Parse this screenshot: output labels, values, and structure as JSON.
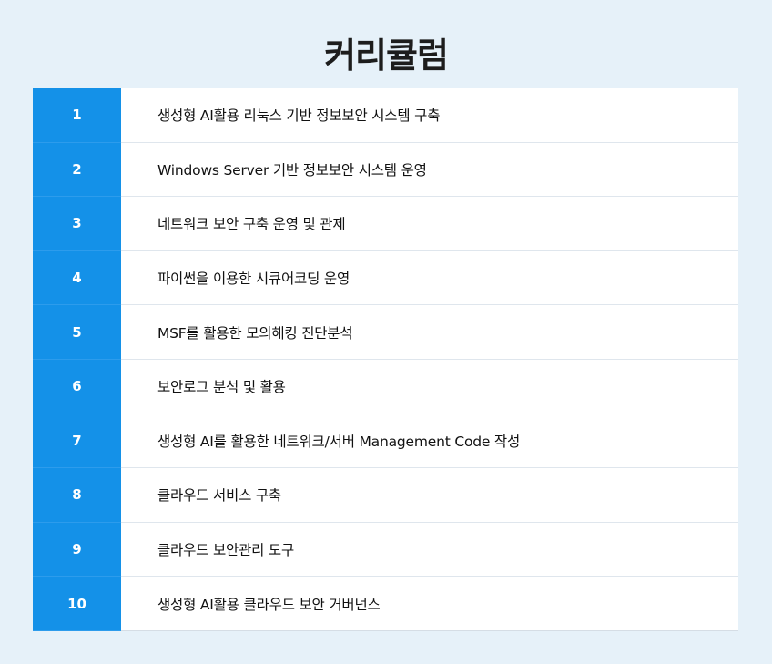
{
  "title": "커리큘럼",
  "colors": {
    "background": "#e6f1f9",
    "number_column": "#1491e8",
    "text": "#111111"
  },
  "curriculum": [
    {
      "number": "1",
      "label": "생성형 AI활용 리눅스 기반 정보보안 시스템 구축"
    },
    {
      "number": "2",
      "label": "Windows Server 기반 정보보안 시스템 운영"
    },
    {
      "number": "3",
      "label": "네트워크 보안 구축 운영 및 관제"
    },
    {
      "number": "4",
      "label": "파이썬을 이용한 시큐어코딩 운영"
    },
    {
      "number": "5",
      "label": "MSF를 활용한 모의해킹 진단분석"
    },
    {
      "number": "6",
      "label": "보안로그 분석 및 활용"
    },
    {
      "number": "7",
      "label": "생성형 AI를 활용한 네트워크/서버 Management Code 작성"
    },
    {
      "number": "8",
      "label": "클라우드 서비스 구축"
    },
    {
      "number": "9",
      "label": "클라우드 보안관리 도구"
    },
    {
      "number": "10",
      "label": "생성형 AI활용 클라우드 보안 거버넌스"
    }
  ]
}
